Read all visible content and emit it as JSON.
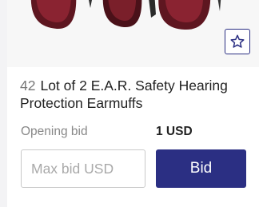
{
  "listing": {
    "lot_number": "42",
    "title": "Lot of 2 E.A.R. Safety Hearing Protection Earmuffs",
    "opening_bid_label": "Opening bid",
    "opening_bid_value": "1 USD",
    "max_bid_placeholder": "Max bid USD",
    "max_bid_value": "",
    "bid_button_label": "Bid",
    "watchlist_icon": "star-icon"
  },
  "colors": {
    "primary": "#2b2f83",
    "earmuff_red": "#7a1f2a",
    "muted_text": "#888888"
  }
}
